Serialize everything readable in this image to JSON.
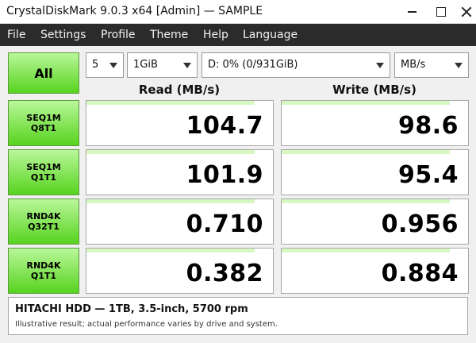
{
  "window": {
    "title": "CrystalDiskMark 9.0.3 x64 [Admin]  —  SAMPLE"
  },
  "menu": [
    "File",
    "Settings",
    "Profile",
    "Theme",
    "Help",
    "Language"
  ],
  "controls": {
    "all_label": "All",
    "count": "5",
    "size": "1GiB",
    "drive": "D: 0% (0/931GiB)",
    "unit": "MB/s"
  },
  "headers": {
    "read": "Read (MB/s)",
    "write": "Write (MB/s)"
  },
  "tests": [
    {
      "line1": "SEQ1M",
      "line2": "Q8T1",
      "read": "104.7",
      "write": "98.6"
    },
    {
      "line1": "SEQ1M",
      "line2": "Q1T1",
      "read": "101.9",
      "write": "95.4"
    },
    {
      "line1": "RND4K",
      "line2": "Q32T1",
      "read": "0.710",
      "write": "0.956"
    },
    {
      "line1": "RND4K",
      "line2": "Q1T1",
      "read": "0.382",
      "write": "0.884"
    }
  ],
  "footer": {
    "drive": "HITACHI HDD — 1TB, 3.5-inch, 5700 rpm",
    "note": "Illustrative result; actual performance varies by drive and system."
  },
  "colors": {
    "button_green_top": "#b9f79a",
    "button_green_bottom": "#57d31e",
    "result_bar": "#d7f7c3",
    "menubar": "#2b2b2b"
  }
}
